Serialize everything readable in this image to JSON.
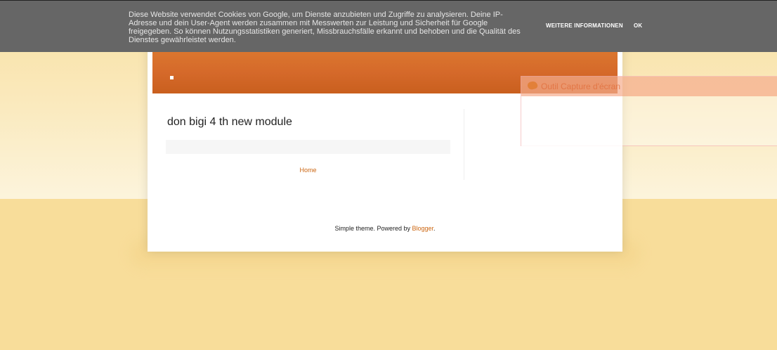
{
  "cookie_notice": {
    "message": "Diese Website verwendet Cookies von Google, um Dienste anzubieten und Zugriffe zu analysieren. Deine IP-Adresse und dein User-Agent werden zusammen mit Messwerten zur Leistung und Sicherheit für Google freigegeben. So können Nutzungsstatistiken generiert, Missbrauchsfälle erkannt und behoben und die Qualität des Dienstes gewährleistet werden.",
    "more_info_label": "Weitere Informationen",
    "ok_label": "OK"
  },
  "post": {
    "title": "don bigi 4 th new module"
  },
  "navigation": {
    "home_label": "Home"
  },
  "footer": {
    "text": "Simple theme. Powered by ",
    "link_label": "Blogger",
    "suffix": "."
  },
  "capture_tool": {
    "title": "Outil Capture d'écran"
  },
  "colors": {
    "accent": "#cc6611",
    "header": "#d5692a",
    "background": "#f8dd9a",
    "cookie_bar": "#666666"
  },
  "icons": {
    "capture_tool": "scissors-snip-icon"
  }
}
